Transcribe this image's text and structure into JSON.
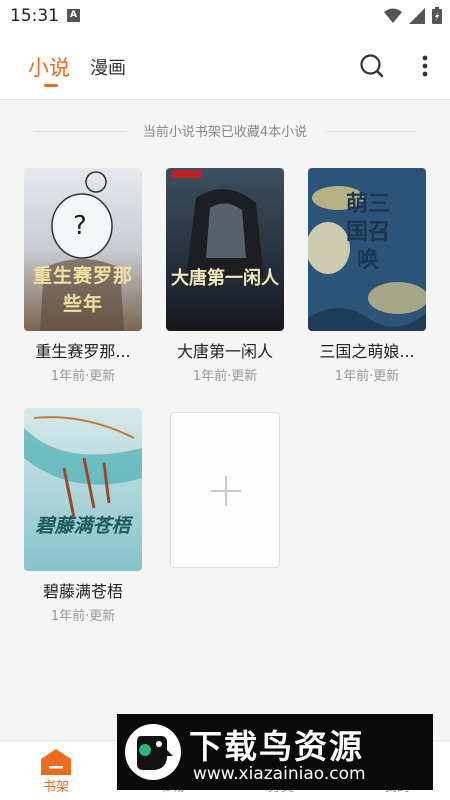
{
  "status_bar": {
    "time": "15:31",
    "notification_glyph": "A"
  },
  "header": {
    "tabs": [
      {
        "label": "小说",
        "active": true
      },
      {
        "label": "漫画",
        "active": false
      }
    ]
  },
  "shelf": {
    "info": "当前小说书架已收藏4本小说",
    "books": [
      {
        "title": "重生赛罗那...",
        "meta": "1年前·更新",
        "cover_text": "重生赛罗那些年",
        "cover_colors": [
          "#e4e7ec",
          "#6e5a47"
        ]
      },
      {
        "title": "大唐第一闲人",
        "meta": "1年前·更新",
        "cover_text": "大唐第一闲人",
        "cover_colors": [
          "#2c3a4a",
          "#1e2228"
        ]
      },
      {
        "title": "三国之萌娘...",
        "meta": "1年前·更新",
        "cover_text": "萌三国召唤",
        "cover_colors": [
          "#2d5c83",
          "#2a4d6e"
        ]
      },
      {
        "title": "碧藤满苍梧",
        "meta": "1年前·更新",
        "cover_text": "碧藤满苍梧",
        "cover_colors": [
          "#cbe3e6",
          "#8fc8cf"
        ]
      }
    ],
    "add_icon": "plus-icon"
  },
  "bottom_nav": [
    {
      "label": "书架",
      "active": true,
      "icon": "bookshelf-icon"
    },
    {
      "label": "书城",
      "active": false,
      "icon": "store-icon"
    },
    {
      "label": "分类",
      "active": false,
      "icon": "category-icon"
    },
    {
      "label": "我的",
      "active": false,
      "icon": "profile-icon"
    }
  ],
  "watermark": {
    "title": "下载鸟资源",
    "url": "www.xiazainiao.com"
  },
  "colors": {
    "accent": "#ec6c1f",
    "background": "#f5f5f5"
  }
}
